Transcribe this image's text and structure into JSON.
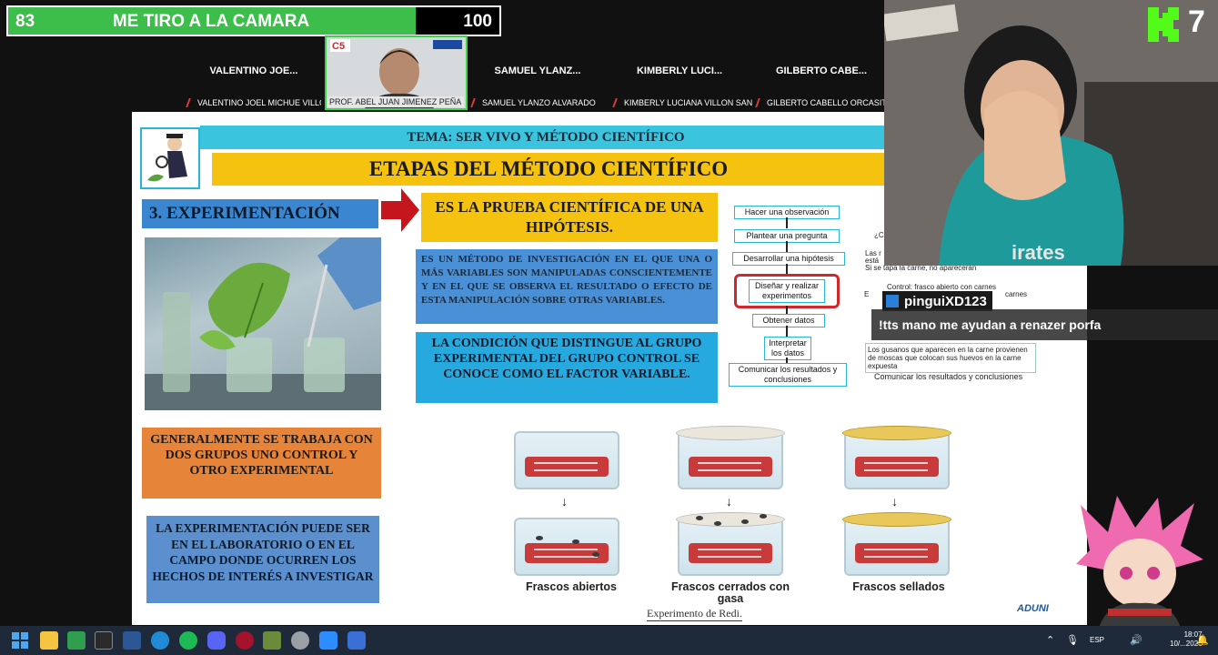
{
  "overlay": {
    "vote_left": "83",
    "vote_title": "ME TIRO A LA CAMARA",
    "vote_right": "100",
    "vote_fill_fraction": 0.83,
    "vote_fill_color": "#3dbd4a"
  },
  "participants": [
    {
      "name": "VALENTINO JOE...",
      "full": "VALENTINO JOEL MICHUE VILLO..."
    },
    {
      "name": "SAMUEL YLANZ...",
      "full": "SAMUEL YLANZO ALVARADO"
    },
    {
      "name": "KIMBERLY LUCI...",
      "full": "KIMBERLY LUCIANA VILLON SAN..."
    },
    {
      "name": "GILBERTO CABE...",
      "full": "GILBERTO CABELLO ORCASITAS"
    }
  ],
  "teacher": {
    "name": "PROF. ABEL JUAN JIMENEZ PEÑA"
  },
  "slide": {
    "tema": "TEMA: SER VIVO Y MÉTODO CIENTÍFICO",
    "etapas": "ETAPAS DEL MÉTODO CIENTÍFICO",
    "exp_title": "3. EXPERIMENTACIÓN",
    "prueba": "ES LA PRUEBA CIENTÍFICA DE UNA HIPÓTESIS.",
    "metodo": "ES UN MÉTODO DE INVESTIGACIÓN EN EL QUE UNA O MÁS VARIABLES SON MANIPULADAS CONSCIENTEMENTE Y EN EL QUE SE OBSERVA EL RESULTADO O EFECTO DE ESTA MANIPULACIÓN SOBRE OTRAS VARIABLES.",
    "condicion": "LA CONDICIÓN QUE DISTINGUE AL GRUPO EXPERIMENTAL DEL GRUPO CONTROL SE CONOCE COMO EL FACTOR VARIABLE.",
    "grupos": "GENERALMENTE SE TRABAJA CON DOS GRUPOS UNO CONTROL Y OTRO EXPERIMENTAL",
    "lab": "LA EXPERIMENTACIÓN PUEDE SER EN EL LABORATORIO O EN EL CAMPO DONDE OCURREN LOS HECHOS DE INTERÉS A INVESTIGAR",
    "flow": [
      "Hacer una observación",
      "Plantear una pregunta",
      "Desarrollar una hipótesis",
      "Diseñar y realizar experimentos",
      "Obtener datos",
      "Interpretar los datos",
      "Comunicar los resultados y conclusiones"
    ],
    "right_col": {
      "q": "¿C",
      "las": "Las r",
      "esta": "está",
      "si": "Si se tapa la carne, no aparecerán",
      "control": "Control: frasco abierto con carnes",
      "e": "E",
      "carnes": "carnes",
      "gusanos": "Los gusanos que aparecen en la carne provienen de moscas que colocan sus huevos en la carne expuesta",
      "comunicar": "Comunicar los resultados y conclusiones"
    },
    "jar_labels": [
      "Frascos abiertos",
      "Frascos cerrados con gasa",
      "Frascos sellados"
    ],
    "redi": "Experimento de Redi.",
    "aduni": "ADUNI"
  },
  "stream": {
    "kick_count": "7",
    "chat_user": "pinguiXD123",
    "chat_message": "!tts mano me ayudan a renazer porfa",
    "kick_color": "#53fc18"
  },
  "taskbar": {
    "lang": "ESP",
    "time": "18:07",
    "date": "10/...2026"
  }
}
